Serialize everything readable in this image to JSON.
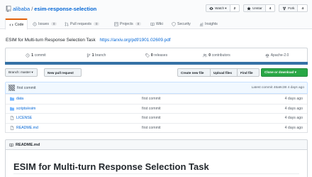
{
  "repo": {
    "owner": "alibaba",
    "separator": "/",
    "name": "esim-response-selection"
  },
  "actions": [
    {
      "label": "Watch ▾",
      "count": "2",
      "icon": "eye-icon"
    },
    {
      "label": "Unstar",
      "count": "4",
      "icon": "star-icon"
    },
    {
      "label": "Fork",
      "count": "4",
      "icon": "fork-icon"
    }
  ],
  "tabs": [
    {
      "label": "Code",
      "icon": "code-icon",
      "count": ""
    },
    {
      "label": "Issues",
      "icon": "issue-icon",
      "count": "0"
    },
    {
      "label": "Pull requests",
      "icon": "pull-request-icon",
      "count": "0"
    },
    {
      "label": "Projects",
      "icon": "project-icon",
      "count": "0"
    },
    {
      "label": "Wiki",
      "icon": "book-icon",
      "count": ""
    },
    {
      "label": "Security",
      "icon": "shield-icon",
      "count": ""
    },
    {
      "label": "Insights",
      "icon": "graph-icon",
      "count": ""
    }
  ],
  "description": {
    "text": "ESIM for Multi-turn Response Selection Task",
    "link": "https://arxiv.org/pdf/1901.02609.pdf"
  },
  "summary": [
    {
      "value": "1",
      "label": "commit",
      "icon": "history-icon"
    },
    {
      "value": "1",
      "label": "branch",
      "icon": "branch-icon"
    },
    {
      "value": "0",
      "label": "releases",
      "icon": "tag-icon"
    },
    {
      "value": "0",
      "label": "contributors",
      "icon": "people-icon"
    },
    {
      "value": "",
      "label": "Apache-2.0",
      "icon": "law-icon"
    }
  ],
  "language_color": "#3572A5",
  "file_nav": {
    "branch": "Branch: master ▾",
    "new_pr": "New pull request",
    "create_file": "Create new file",
    "upload": "Upload files",
    "find": "Find file",
    "clone": "Clone or download ▾"
  },
  "latest_commit": {
    "message": "first commit",
    "meta": "Latest commit 46a9c38 4 days ago"
  },
  "files": [
    {
      "name": "data",
      "type": "dir",
      "message": "first commit",
      "age": "4 days ago"
    },
    {
      "name": "scripts/esim",
      "type": "dir",
      "message": "first commit",
      "age": "4 days ago"
    },
    {
      "name": "LICENSE",
      "type": "file",
      "message": "first commit",
      "age": "4 days ago"
    },
    {
      "name": "README.md",
      "type": "file",
      "message": "first commit",
      "age": "4 days ago"
    }
  ],
  "readme": {
    "filename": "README.md",
    "title": "ESIM for Multi-turn Response Selection Task"
  }
}
